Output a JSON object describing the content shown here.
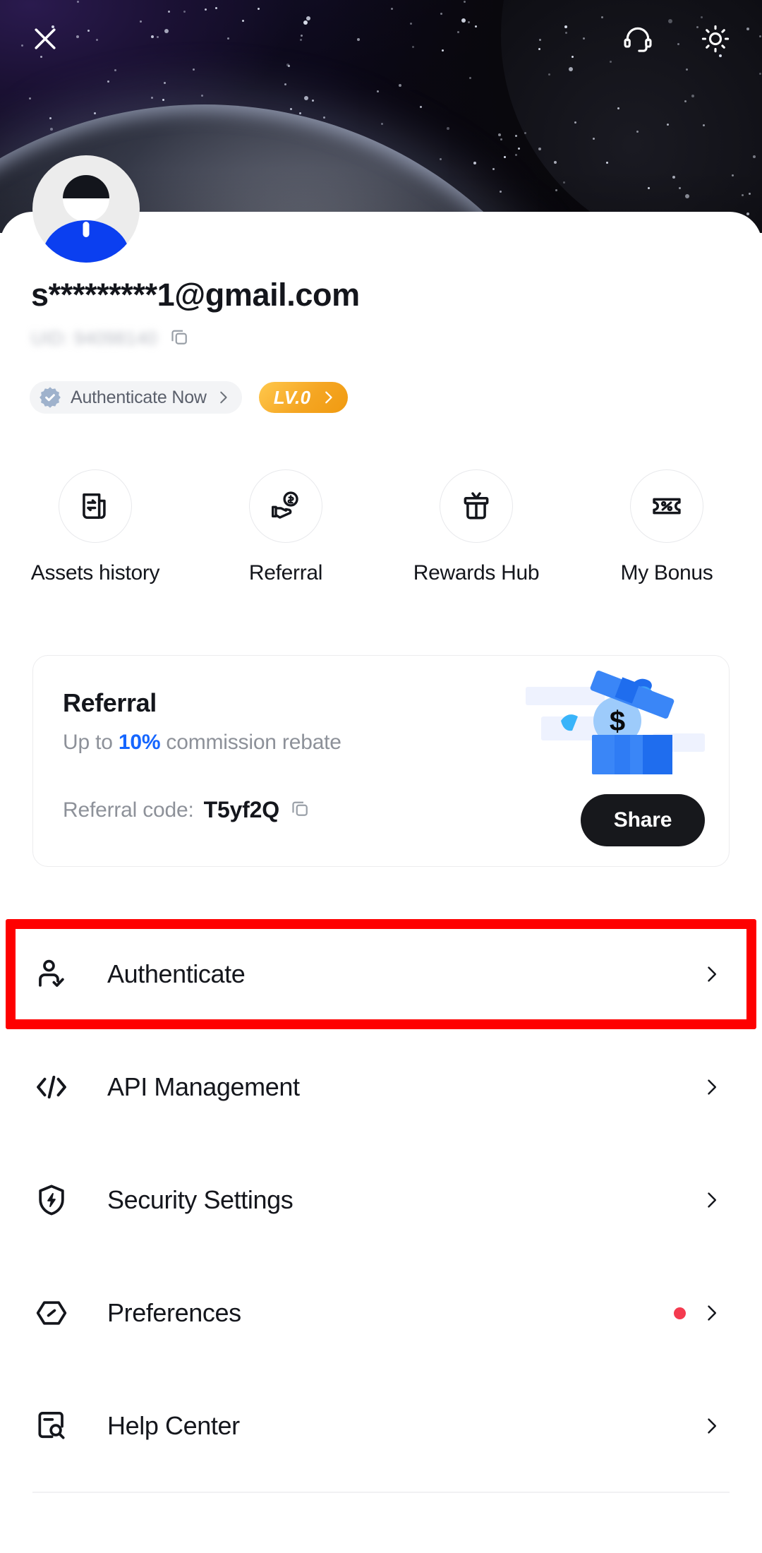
{
  "topbar": {
    "close_label": "close-icon",
    "support_label": "customer-support-headset-icon",
    "theme_label": "light-mode-sun-icon"
  },
  "profile": {
    "email": "s*********1@gmail.com",
    "uid": "UID: 94098140",
    "copy_uid_label": "copy-icon",
    "auth_badge": {
      "label": "Authenticate Now",
      "chevron": "›"
    },
    "level_badge": {
      "label": "LV.0",
      "chevron": "›"
    }
  },
  "quick_actions": [
    {
      "label": "Assets history",
      "icon": "assets-history-icon"
    },
    {
      "label": "Referral",
      "icon": "referral-hand-coin-icon"
    },
    {
      "label": "Rewards Hub",
      "icon": "gift-box-icon"
    },
    {
      "label": "My Bonus",
      "icon": "percent-ticket-icon"
    }
  ],
  "referral_card": {
    "title": "Referral",
    "subtitle_prefix": "Up to ",
    "subtitle_highlight": "10%",
    "subtitle_suffix": " commission rebate",
    "code_label": "Referral code:",
    "code_value": "T5yf2Q",
    "copy_code_label": "copy-icon",
    "share_button": "Share",
    "illustration": "gift-box-with-money-bag"
  },
  "menu": [
    {
      "label": "Authenticate",
      "icon": "user-check-icon",
      "chevron": "›",
      "dot": false,
      "highlighted": true
    },
    {
      "label": "API Management",
      "icon": "code-brackets-icon",
      "chevron": "›",
      "dot": false,
      "highlighted": false
    },
    {
      "label": "Security Settings",
      "icon": "shield-bolt-icon",
      "chevron": "›",
      "dot": false,
      "highlighted": false
    },
    {
      "label": "Preferences",
      "icon": "hex-slider-icon",
      "chevron": "›",
      "dot": true,
      "highlighted": false
    },
    {
      "label": "Help Center",
      "icon": "doc-search-icon",
      "chevron": "›",
      "dot": false,
      "highlighted": false
    }
  ],
  "colors": {
    "accent_blue": "#1566ff",
    "level_orange": "#f5a623",
    "notification_red": "#f43a4f",
    "highlight_red": "#fe0000",
    "text_primary": "#14161c",
    "text_muted": "#8d9199"
  }
}
